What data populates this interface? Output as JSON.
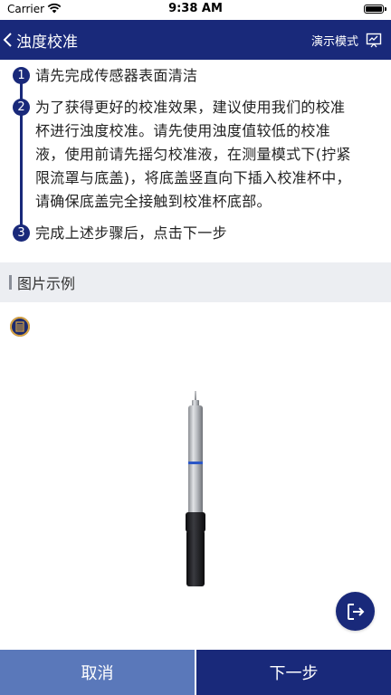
{
  "status_bar": {
    "carrier": "Carrier",
    "time": "9:38 AM"
  },
  "nav": {
    "title": "浊度校准",
    "demo_mode": "演示模式"
  },
  "steps": [
    {
      "num": "1",
      "lines": [
        "请先完成传感器表面清洁"
      ]
    },
    {
      "num": "2",
      "lines": [
        "为了获得更好的校准效果，建议使用我们的校准",
        "杯进行浊度校准。请先使用浊度值较低的校准",
        "液，使用前请先摇匀校准液，在测量模式下(拧紧",
        "限流罩与底盖)，将底盖竖直向下插入校准杯中，",
        "请确保底盖完全接触到校准杯底部。"
      ]
    },
    {
      "num": "3",
      "lines": [
        "完成上述步骤后，点击下一步"
      ]
    }
  ],
  "section": {
    "label": "图片示例"
  },
  "buttons": {
    "cancel": "取消",
    "next": "下一步"
  },
  "colors": {
    "primary": "#19297a",
    "secondary": "#5a78ba",
    "section_bg": "#eceef2"
  },
  "icons": {
    "back": "chevron-left-icon",
    "demo": "slideshow-icon",
    "example": "calibration-cup-icon",
    "exit": "exit-icon"
  }
}
